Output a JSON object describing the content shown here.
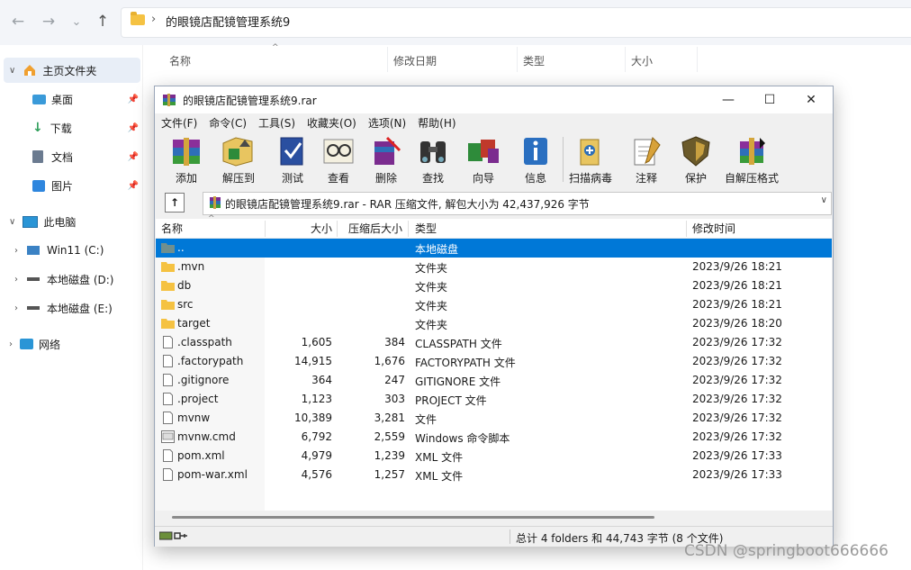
{
  "explorer": {
    "path": "的眼镜店配镜管理系统9",
    "path_sep": "›",
    "nav": {
      "back": "←",
      "forward": "→",
      "recent": "⌄",
      "up": "↑"
    },
    "columns": [
      "名称",
      "修改日期",
      "类型",
      "大小"
    ],
    "sidebar": {
      "home": "主页文件夹",
      "desktop": "桌面",
      "downloads": "下载",
      "documents": "文档",
      "pictures": "图片",
      "this_pc": "此电脑",
      "drive_c": "Win11 (C:)",
      "drive_d": "本地磁盘 (D:)",
      "drive_e": "本地磁盘 (E:)",
      "network": "网络"
    }
  },
  "rar": {
    "title": "的眼镜店配镜管理系统9.rar",
    "window_buttons": {
      "minimize": "—",
      "maximize": "☐",
      "close": "✕"
    },
    "menu": [
      "文件(F)",
      "命令(C)",
      "工具(S)",
      "收藏夹(O)",
      "选项(N)",
      "帮助(H)"
    ],
    "toolbar": [
      {
        "label": "添加",
        "icon": "add-icon"
      },
      {
        "label": "解压到",
        "icon": "extract-icon"
      },
      {
        "label": "测试",
        "icon": "test-icon"
      },
      {
        "label": "查看",
        "icon": "view-icon"
      },
      {
        "label": "删除",
        "icon": "delete-icon"
      },
      {
        "label": "查找",
        "icon": "find-icon"
      },
      {
        "label": "向导",
        "icon": "wizard-icon"
      },
      {
        "label": "信息",
        "icon": "info-icon"
      },
      {
        "label": "扫描病毒",
        "icon": "virus-scan-icon"
      },
      {
        "label": "注释",
        "icon": "comment-icon"
      },
      {
        "label": "保护",
        "icon": "protect-icon"
      },
      {
        "label": "自解压格式",
        "icon": "sfx-icon"
      }
    ],
    "path_text": "的眼镜店配镜管理系统9.rar - RAR 压缩文件, 解包大小为 42,437,926 字节",
    "columns": {
      "name": "名称",
      "size": "大小",
      "packed": "压缩后大小",
      "type": "类型",
      "modified": "修改时间"
    },
    "files": [
      {
        "name": "..",
        "size": "",
        "packed": "",
        "type": "本地磁盘",
        "modified": "",
        "kind": "up",
        "selected": true
      },
      {
        "name": ".mvn",
        "size": "",
        "packed": "",
        "type": "文件夹",
        "modified": "2023/9/26 18:21",
        "kind": "folder"
      },
      {
        "name": "db",
        "size": "",
        "packed": "",
        "type": "文件夹",
        "modified": "2023/9/26 18:21",
        "kind": "folder"
      },
      {
        "name": "src",
        "size": "",
        "packed": "",
        "type": "文件夹",
        "modified": "2023/9/26 18:21",
        "kind": "folder"
      },
      {
        "name": "target",
        "size": "",
        "packed": "",
        "type": "文件夹",
        "modified": "2023/9/26 18:20",
        "kind": "folder"
      },
      {
        "name": ".classpath",
        "size": "1,605",
        "packed": "384",
        "type": "CLASSPATH 文件",
        "modified": "2023/9/26 17:32",
        "kind": "file"
      },
      {
        "name": ".factorypath",
        "size": "14,915",
        "packed": "1,676",
        "type": "FACTORYPATH 文件",
        "modified": "2023/9/26 17:32",
        "kind": "file"
      },
      {
        "name": ".gitignore",
        "size": "364",
        "packed": "247",
        "type": "GITIGNORE 文件",
        "modified": "2023/9/26 17:32",
        "kind": "file"
      },
      {
        "name": ".project",
        "size": "1,123",
        "packed": "303",
        "type": "PROJECT 文件",
        "modified": "2023/9/26 17:32",
        "kind": "file"
      },
      {
        "name": "mvnw",
        "size": "10,389",
        "packed": "3,281",
        "type": "文件",
        "modified": "2023/9/26 17:32",
        "kind": "file"
      },
      {
        "name": "mvnw.cmd",
        "size": "6,792",
        "packed": "2,559",
        "type": "Windows 命令脚本",
        "modified": "2023/9/26 17:32",
        "kind": "cmd"
      },
      {
        "name": "pom.xml",
        "size": "4,979",
        "packed": "1,239",
        "type": "XML 文件",
        "modified": "2023/9/26 17:33",
        "kind": "file"
      },
      {
        "name": "pom-war.xml",
        "size": "4,576",
        "packed": "1,257",
        "type": "XML 文件",
        "modified": "2023/9/26 17:33",
        "kind": "file"
      }
    ],
    "status_text": "总计 4 folders 和 44,743 字节 (8 个文件)"
  },
  "watermark": "CSDN @springboot666666",
  "colors": {
    "selection": "#0078d7",
    "folder": "#f5c242",
    "explorer_bg": "#f3f5f9"
  }
}
